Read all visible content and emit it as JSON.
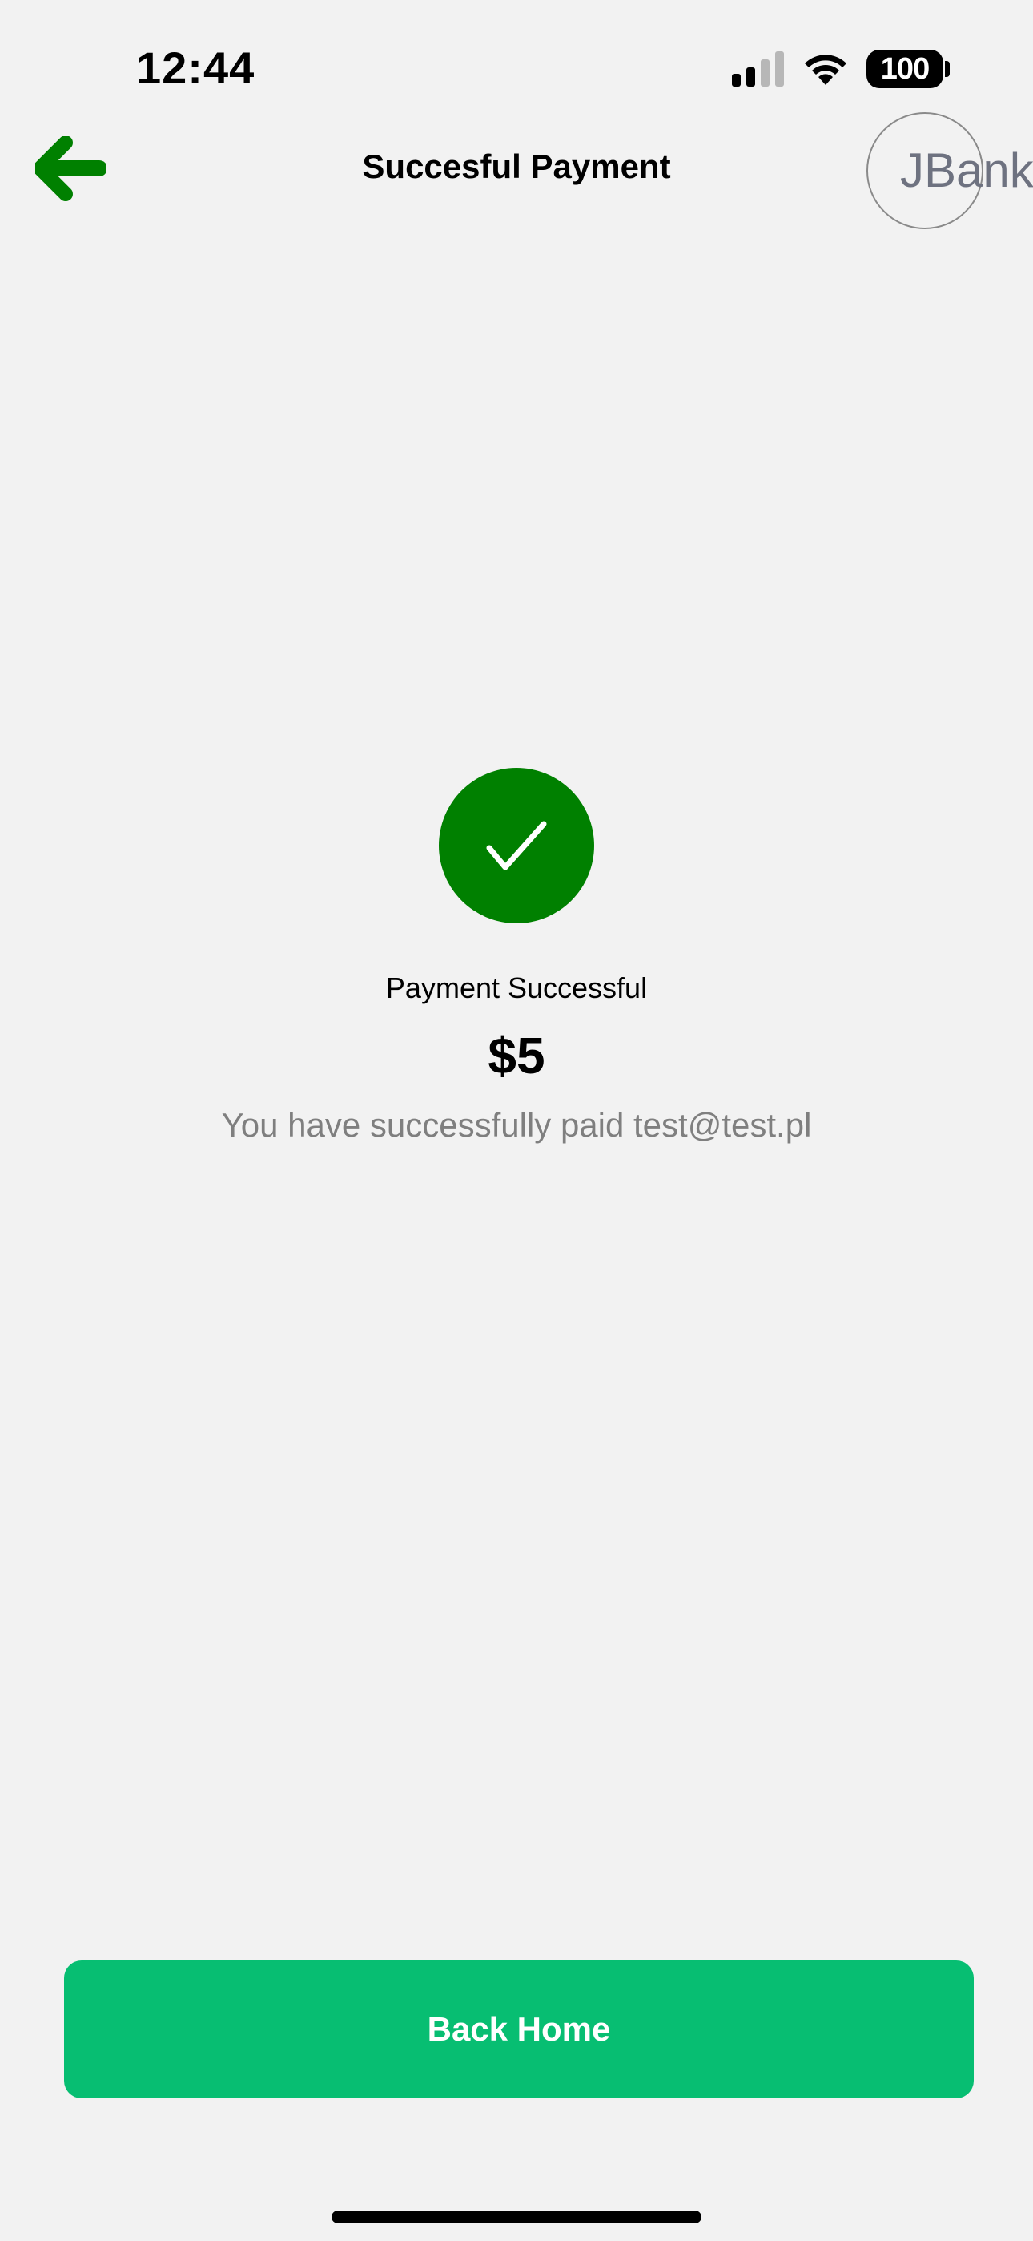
{
  "status_bar": {
    "time": "12:44",
    "battery": "100"
  },
  "nav": {
    "title": "Succesful Payment",
    "back_icon": "arrow-left-icon",
    "logo_text": "JBank"
  },
  "result": {
    "icon": "checkmark-icon",
    "label": "Payment Successful",
    "amount": "$5",
    "description": "You have successfully paid test@test.pl"
  },
  "actions": {
    "back_home_label": "Back Home"
  },
  "colors": {
    "accent_dark_green": "#008000",
    "button_green": "#07be72",
    "background": "#f2f2f2",
    "muted_text": "#7f7f7f"
  }
}
